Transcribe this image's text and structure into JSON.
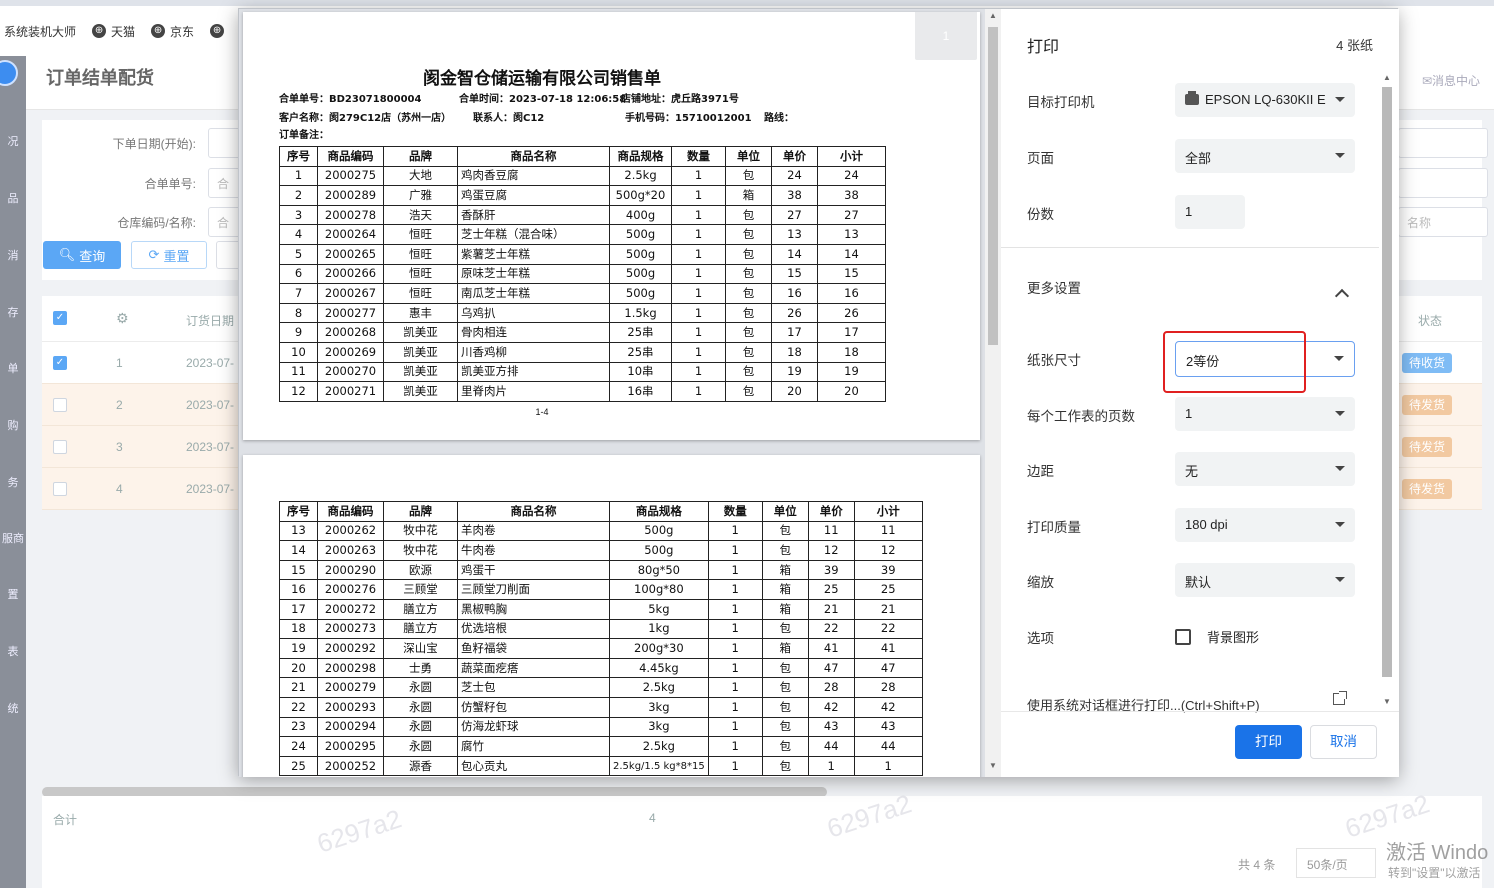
{
  "browser": {
    "bookmarks": [
      {
        "label": "系统装机大师"
      },
      {
        "label": "天猫"
      },
      {
        "label": "京东"
      }
    ]
  },
  "app": {
    "title": "订单结单配货",
    "msg_center": "✉消息中心",
    "rail": [
      "况",
      "品",
      "消",
      "存",
      "单",
      "购",
      "务",
      "服商",
      "置",
      "表",
      "统"
    ],
    "filters": {
      "order_date_label": "下单日期(开始):",
      "order_no_label": "合单单号:",
      "warehouse_label": "仓库编码/名称:",
      "order_no_placeholder": "合",
      "warehouse_placeholder": "合",
      "name_placeholder": "名称"
    },
    "query_label": "查询",
    "reset_label": "重置",
    "table": {
      "order_date_header": "订货日期",
      "status_header": "状态",
      "rows": [
        {
          "idx": "1",
          "date": "2023-07-",
          "status": "待收货",
          "status_color": "#7fbcf5"
        },
        {
          "idx": "2",
          "date": "2023-07-",
          "status": "待发货",
          "status_color": "#f2c9a1"
        },
        {
          "idx": "3",
          "date": "2023-07-",
          "status": "待发货",
          "status_color": "#f2c9a1"
        },
        {
          "idx": "4",
          "date": "2023-07-",
          "status": "待发货",
          "status_color": "#f2c9a1"
        }
      ]
    },
    "footer": {
      "total_label": "合计",
      "total_value": "4",
      "pager_total": "共 4 条",
      "pager_size": "50条/页"
    },
    "watermark": "6297a2",
    "activate_line1": "激活 Windo",
    "activate_line2": "转到\"设置\"以激活"
  },
  "print_dialog": {
    "title": "打印",
    "sheets": "4 张纸",
    "page_indicator": "1",
    "settings": {
      "printer_label": "目标打印机",
      "printer_value": "EPSON LQ-630KII E",
      "pages_label": "页面",
      "pages_value": "全部",
      "copies_label": "份数",
      "copies_value": "1",
      "more_label": "更多设置",
      "paper_label": "纸张尺寸",
      "paper_value": "2等份",
      "per_sheet_label": "每个工作表的页数",
      "per_sheet_value": "1",
      "margin_label": "边距",
      "margin_value": "无",
      "quality_label": "打印质量",
      "quality_value": "180 dpi",
      "scale_label": "缩放",
      "scale_value": "默认",
      "options_label": "选项",
      "bg_graphics_label": "背景图形",
      "system_dialog_label": "使用系统对话框进行打印...(Ctrl+Shift+P)"
    },
    "print_label": "打印",
    "cancel_label": "取消",
    "accent_color": "#1a73e8"
  },
  "document": {
    "title": "阂金智仓储运输有限公司销售单",
    "meta": {
      "order_no": "合单单号：BD23071800004",
      "order_time": "合单时间：2023-07-18 12:06:58",
      "shop_addr": "店铺地址：虎丘路3971号",
      "customer": "客户名称：阂279C12店（苏州一店）",
      "contact": "联系人：阂C12",
      "phone": "手机号码：15710012001",
      "route": "路线：",
      "remark": "订单备注："
    },
    "page1_footer": "1-4",
    "headers": [
      "序号",
      "商品编码",
      "品牌",
      "商品名称",
      "商品规格",
      "数量",
      "单位",
      "单价",
      "小计"
    ],
    "page1_rows": [
      [
        "1",
        "2000275",
        "大地",
        "鸡肉香豆腐",
        "2.5kg",
        "1",
        "包",
        "24",
        "24"
      ],
      [
        "2",
        "2000289",
        "广雅",
        "鸡蛋豆腐",
        "500g*20",
        "1",
        "箱",
        "38",
        "38"
      ],
      [
        "3",
        "2000278",
        "浩天",
        "香酥肝",
        "400g",
        "1",
        "包",
        "27",
        "27"
      ],
      [
        "4",
        "2000264",
        "恒旺",
        "芝士年糕（混合味）",
        "500g",
        "1",
        "包",
        "13",
        "13"
      ],
      [
        "5",
        "2000265",
        "恒旺",
        "紫薯芝士年糕",
        "500g",
        "1",
        "包",
        "14",
        "14"
      ],
      [
        "6",
        "2000266",
        "恒旺",
        "原味芝士年糕",
        "500g",
        "1",
        "包",
        "15",
        "15"
      ],
      [
        "7",
        "2000267",
        "恒旺",
        "南瓜芝士年糕",
        "500g",
        "1",
        "包",
        "16",
        "16"
      ],
      [
        "8",
        "2000277",
        "惠丰",
        "乌鸡扒",
        "1.5kg",
        "1",
        "包",
        "26",
        "26"
      ],
      [
        "9",
        "2000268",
        "凯美亚",
        "骨肉相连",
        "25串",
        "1",
        "包",
        "17",
        "17"
      ],
      [
        "10",
        "2000269",
        "凯美亚",
        "川香鸡柳",
        "25串",
        "1",
        "包",
        "18",
        "18"
      ],
      [
        "11",
        "2000270",
        "凯美亚",
        "凯美亚方排",
        "10串",
        "1",
        "包",
        "19",
        "19"
      ],
      [
        "12",
        "2000271",
        "凯美亚",
        "里脊肉片",
        "16串",
        "1",
        "包",
        "20",
        "20"
      ]
    ],
    "page2_rows": [
      [
        "13",
        "2000262",
        "牧中花",
        "羊肉卷",
        "500g",
        "1",
        "包",
        "11",
        "11"
      ],
      [
        "14",
        "2000263",
        "牧中花",
        "牛肉卷",
        "500g",
        "1",
        "包",
        "12",
        "12"
      ],
      [
        "15",
        "2000290",
        "欧源",
        "鸡蛋干",
        "80g*50",
        "1",
        "箱",
        "39",
        "39"
      ],
      [
        "16",
        "2000276",
        "三顾堂",
        "三顾堂刀削面",
        "100g*80",
        "1",
        "箱",
        "25",
        "25"
      ],
      [
        "17",
        "2000272",
        "膳立方",
        "黑椒鸭胸",
        "5kg",
        "1",
        "箱",
        "21",
        "21"
      ],
      [
        "18",
        "2000273",
        "膳立方",
        "优选培根",
        "1kg",
        "1",
        "包",
        "22",
        "22"
      ],
      [
        "19",
        "2000292",
        "深山宝",
        "鱼籽福袋",
        "200g*30",
        "1",
        "箱",
        "41",
        "41"
      ],
      [
        "20",
        "2000298",
        "士勇",
        "蔬菜面疙瘩",
        "4.45kg",
        "1",
        "包",
        "47",
        "47"
      ],
      [
        "21",
        "2000279",
        "永圆",
        "芝士包",
        "2.5kg",
        "1",
        "包",
        "28",
        "28"
      ],
      [
        "22",
        "2000293",
        "永圆",
        "仿蟹籽包",
        "3kg",
        "1",
        "包",
        "42",
        "42"
      ],
      [
        "23",
        "2000294",
        "永圆",
        "仿海龙虾球",
        "3kg",
        "1",
        "包",
        "43",
        "43"
      ],
      [
        "24",
        "2000295",
        "永圆",
        "腐竹",
        "2.5kg",
        "1",
        "包",
        "44",
        "44"
      ],
      [
        "25",
        "2000252",
        "源香",
        "包心贡丸",
        "2.5kg/1.5 kg*8*15",
        "1",
        "包",
        "1",
        "1"
      ]
    ]
  }
}
